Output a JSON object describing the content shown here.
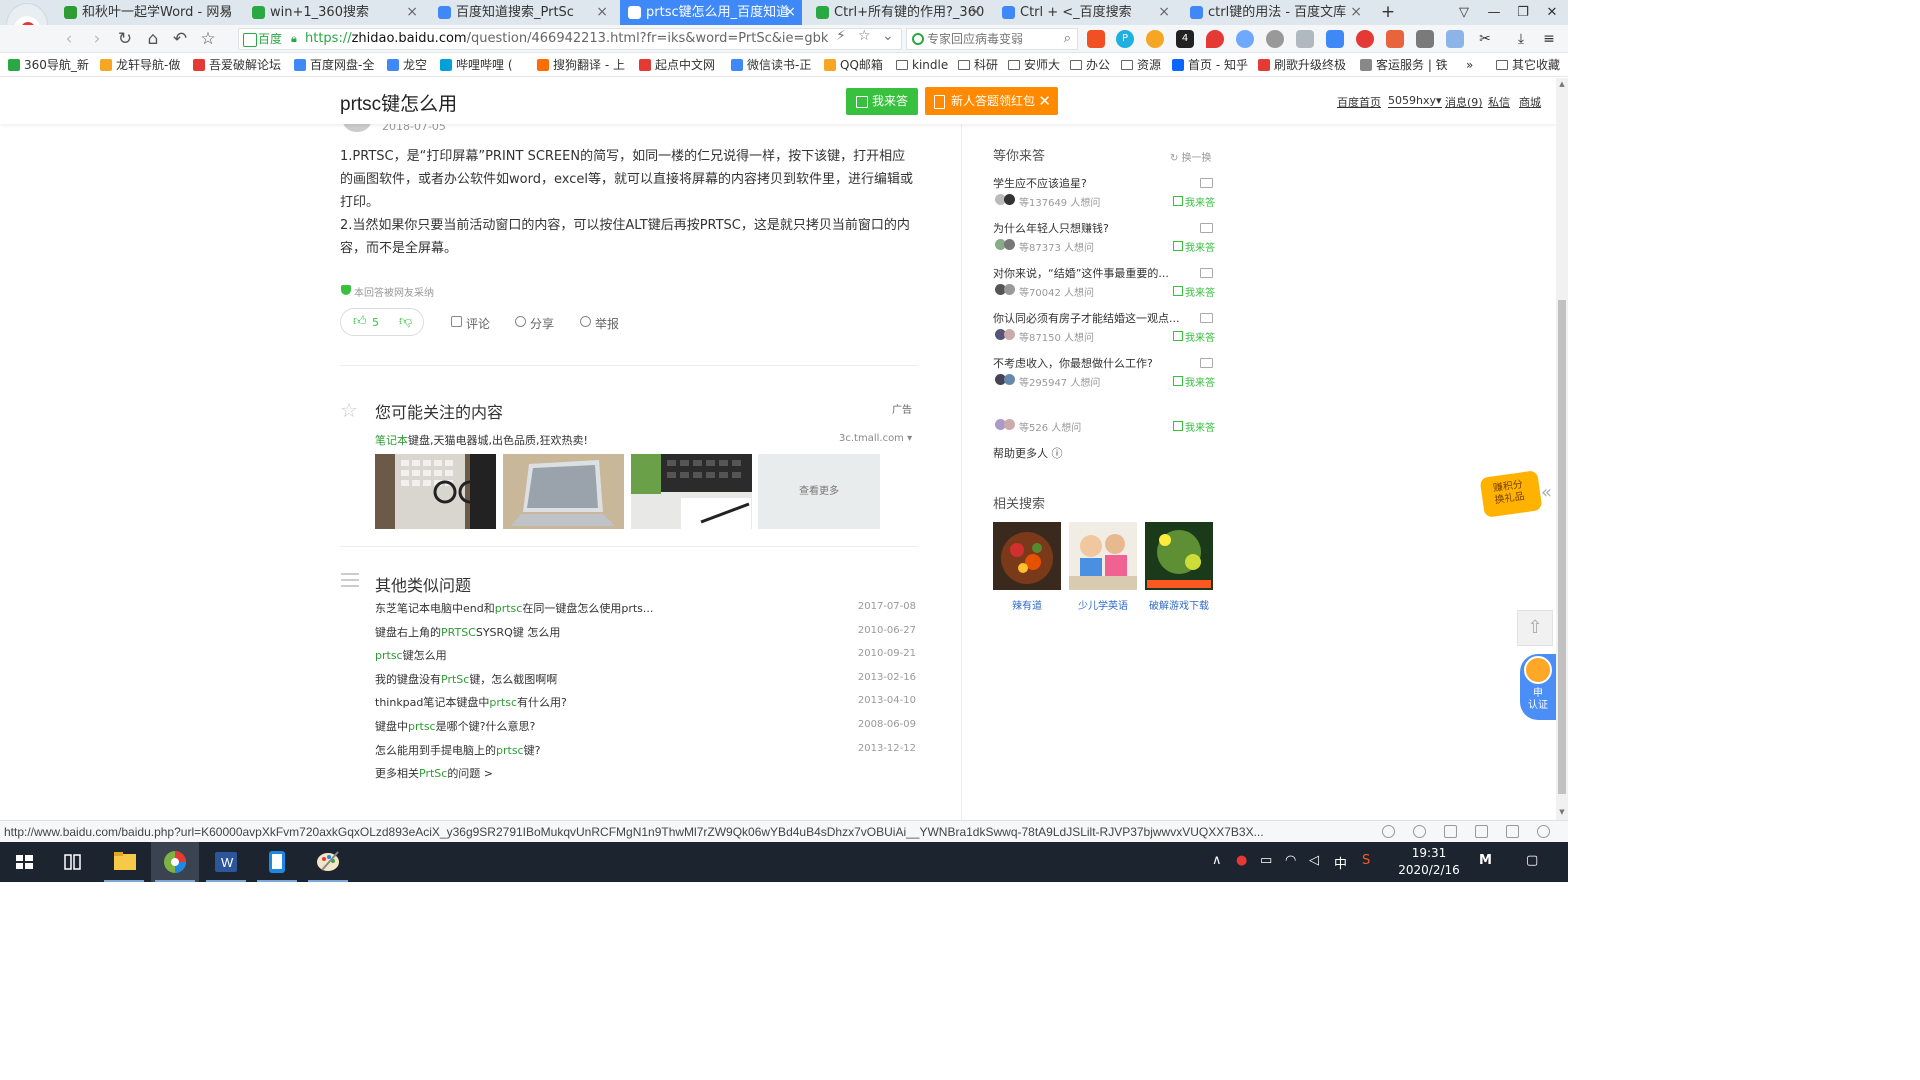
{
  "browser": {
    "tabs": [
      {
        "label": "和秋叶一起学Word - 网易",
        "icon_color": "#2e9c34",
        "active": false
      },
      {
        "label": "win+1_360搜索",
        "icon_color": "#2aa843",
        "active": false
      },
      {
        "label": "百度知道搜索_PrtSc",
        "icon_color": "#3f88f7",
        "active": false
      },
      {
        "label": "prtsc键怎么用_百度知道",
        "icon_color": "#ffffff",
        "active": true
      },
      {
        "label": "Ctrl+所有键的作用?_360",
        "icon_color": "#2aa843",
        "active": false
      },
      {
        "label": "Ctrl + <_百度搜索",
        "icon_color": "#3f88f7",
        "active": false
      },
      {
        "label": "ctrl键的用法 - 百度文库",
        "icon_color": "#3f88f7",
        "active": false
      }
    ],
    "new_tab": "+",
    "close_glyph": "×",
    "address": {
      "site_badge": "百度",
      "scheme": "https://",
      "host": "zhidao.baidu.com",
      "path": "/question/466942213.html?fr=iks&word=PrtSc&ie=gbk"
    },
    "search_placeholder": "专家回应病毒变弱",
    "bookmarks": [
      {
        "label": "360导航_新",
        "color": "#2aa843",
        "type": "site"
      },
      {
        "label": "龙轩导航-做",
        "color": "#f5a623",
        "type": "site"
      },
      {
        "label": "吾爱破解论坛",
        "color": "#e53935",
        "type": "site"
      },
      {
        "label": "百度网盘-全",
        "color": "#3f88f7",
        "type": "site"
      },
      {
        "label": "龙空",
        "color": "#3f88f7",
        "type": "site"
      },
      {
        "label": "哔哩哔哩 (",
        "color": "#00a1d6",
        "type": "site"
      },
      {
        "label": "搜狗翻译 - 上",
        "color": "#ff6d00",
        "type": "site"
      },
      {
        "label": "起点中文网",
        "color": "#e53935",
        "type": "site"
      },
      {
        "label": "微信读书-正",
        "color": "#3f88f7",
        "type": "site"
      },
      {
        "label": "QQ邮箱",
        "color": "#f5a623",
        "type": "site"
      },
      {
        "label": "kindle",
        "color": "",
        "type": "folder"
      },
      {
        "label": "科研",
        "color": "",
        "type": "folder"
      },
      {
        "label": "安师大",
        "color": "",
        "type": "folder"
      },
      {
        "label": "办公",
        "color": "",
        "type": "folder"
      },
      {
        "label": "资源",
        "color": "",
        "type": "folder"
      },
      {
        "label": "首页 - 知乎",
        "color": "#0a66ff",
        "type": "site"
      },
      {
        "label": "刷歌升级终极",
        "color": "#e53935",
        "type": "site"
      },
      {
        "label": "客运服务 | 铁",
        "color": "#888888",
        "type": "site"
      },
      {
        "label": "其它收藏",
        "color": "",
        "type": "folder"
      }
    ],
    "bookmarks_more": "»",
    "status_url": "http://www.baidu.com/baidu.php?url=K60000avpXkFvm720axkGqxOLzd893eAciX_y36g9SR2791IBoMukqvUnRCFMgN1n9ThwMl7rZW9Qk06wYBd4uB4sDhzx7vOBUiAi__YWNBra1dkSwwq-78tA9LdJSLilt-RJVP37bjwwvxVUQXX7B3X..."
  },
  "page": {
    "title": "prtsc键怎么用",
    "btn_answer": "我来答",
    "btn_redpack": "新人答题领红包",
    "top_links": [
      "百度首页",
      "5059hxy▾",
      "消息(9)",
      "私信",
      "商城"
    ],
    "answer_date": "2018-07-05",
    "answer_paragraphs": [
      "1.PRTSC，是“打印屏幕”PRINT SCREEN的简写，如同一楼的仁兄说得一样，按下该键，打开相应的画图软件，或者办公软件如word，excel等，就可以直接将屏幕的内容拷贝到软件里，进行编辑或打印。",
      "2.当然如果你只要当前活动窗口的内容，可以按住ALT键后再按PRTSC，这是就只拷贝当前窗口的内容，而不是全屏幕。"
    ],
    "adopted_note": "本回答被网友采纳",
    "votes_up": "5",
    "actions": [
      "评论",
      "分享",
      "举报"
    ],
    "interest_title": "您可能关注的内容",
    "ad_tag": "广告",
    "ad_headline_hl": "笔记本",
    "ad_headline_rest": "键盘,天猫电器城,出色品质,狂欢热卖!",
    "ad_domain": "3c.tmall.com",
    "ad_more": "查看更多",
    "similar_title": "其他类似问题",
    "similar": [
      {
        "parts": [
          "东芝笔记本电脑中end和",
          "prtsc",
          "在同一键盘怎么使用prts..."
        ],
        "date": "2017-07-08"
      },
      {
        "parts": [
          "键盘右上角的",
          "PRTSC",
          "SYSRQ键 怎么用"
        ],
        "date": "2010-06-27"
      },
      {
        "parts": [
          "",
          "prtsc",
          "键怎么用"
        ],
        "date": "2010-09-21"
      },
      {
        "parts": [
          "我的键盘没有",
          "PrtSc",
          "键，怎么截图啊啊"
        ],
        "date": "2013-02-16"
      },
      {
        "parts": [
          "thinkpad笔记本键盘中",
          "prtsc",
          "有什么用?"
        ],
        "date": "2013-04-10"
      },
      {
        "parts": [
          "键盘中",
          "prtsc",
          "是哪个键?什么意思?"
        ],
        "date": "2008-06-09"
      },
      {
        "parts": [
          "怎么能用到手提电脑上的",
          "prtsc",
          "键?"
        ],
        "date": "2013-12-12"
      }
    ],
    "more_similar": {
      "pre": "更多相关",
      "hl": "PrtSc",
      "post": "的问题 >"
    }
  },
  "sidebar": {
    "waiting_title": "等你来答",
    "refresh": "换一换",
    "answer_label": "我来答",
    "questions": [
      {
        "title": "学生应不应该追星?",
        "waiting": "等137649 人想问"
      },
      {
        "title": "为什么年轻人只想赚钱?",
        "waiting": "等87373 人想问"
      },
      {
        "title": "对你来说，“结婚”这件事最重要的...",
        "waiting": "等70042 人想问"
      },
      {
        "title": "你认同必须有房子才能结婚这一观点...",
        "waiting": "等87150 人想问"
      },
      {
        "title": "不考虑收入，你最想做什么工作?",
        "waiting": "等295947 人想问"
      },
      {
        "title": "",
        "waiting": "等526 人想问"
      }
    ],
    "help_more": "帮助更多人",
    "related_title": "相关搜索",
    "related": [
      "辣有道",
      "少儿学英语",
      "破解游戏下载"
    ],
    "float_badge": "赚积分\n换礼品",
    "cert_label": "申\n认证"
  },
  "taskbar": {
    "time": "19:31",
    "date": "2020/2/16",
    "ime": "中"
  },
  "colors": {
    "accent_green": "#38c13f",
    "tab_active": "#3f88f7",
    "redpack_orange": "#ff8a00"
  }
}
